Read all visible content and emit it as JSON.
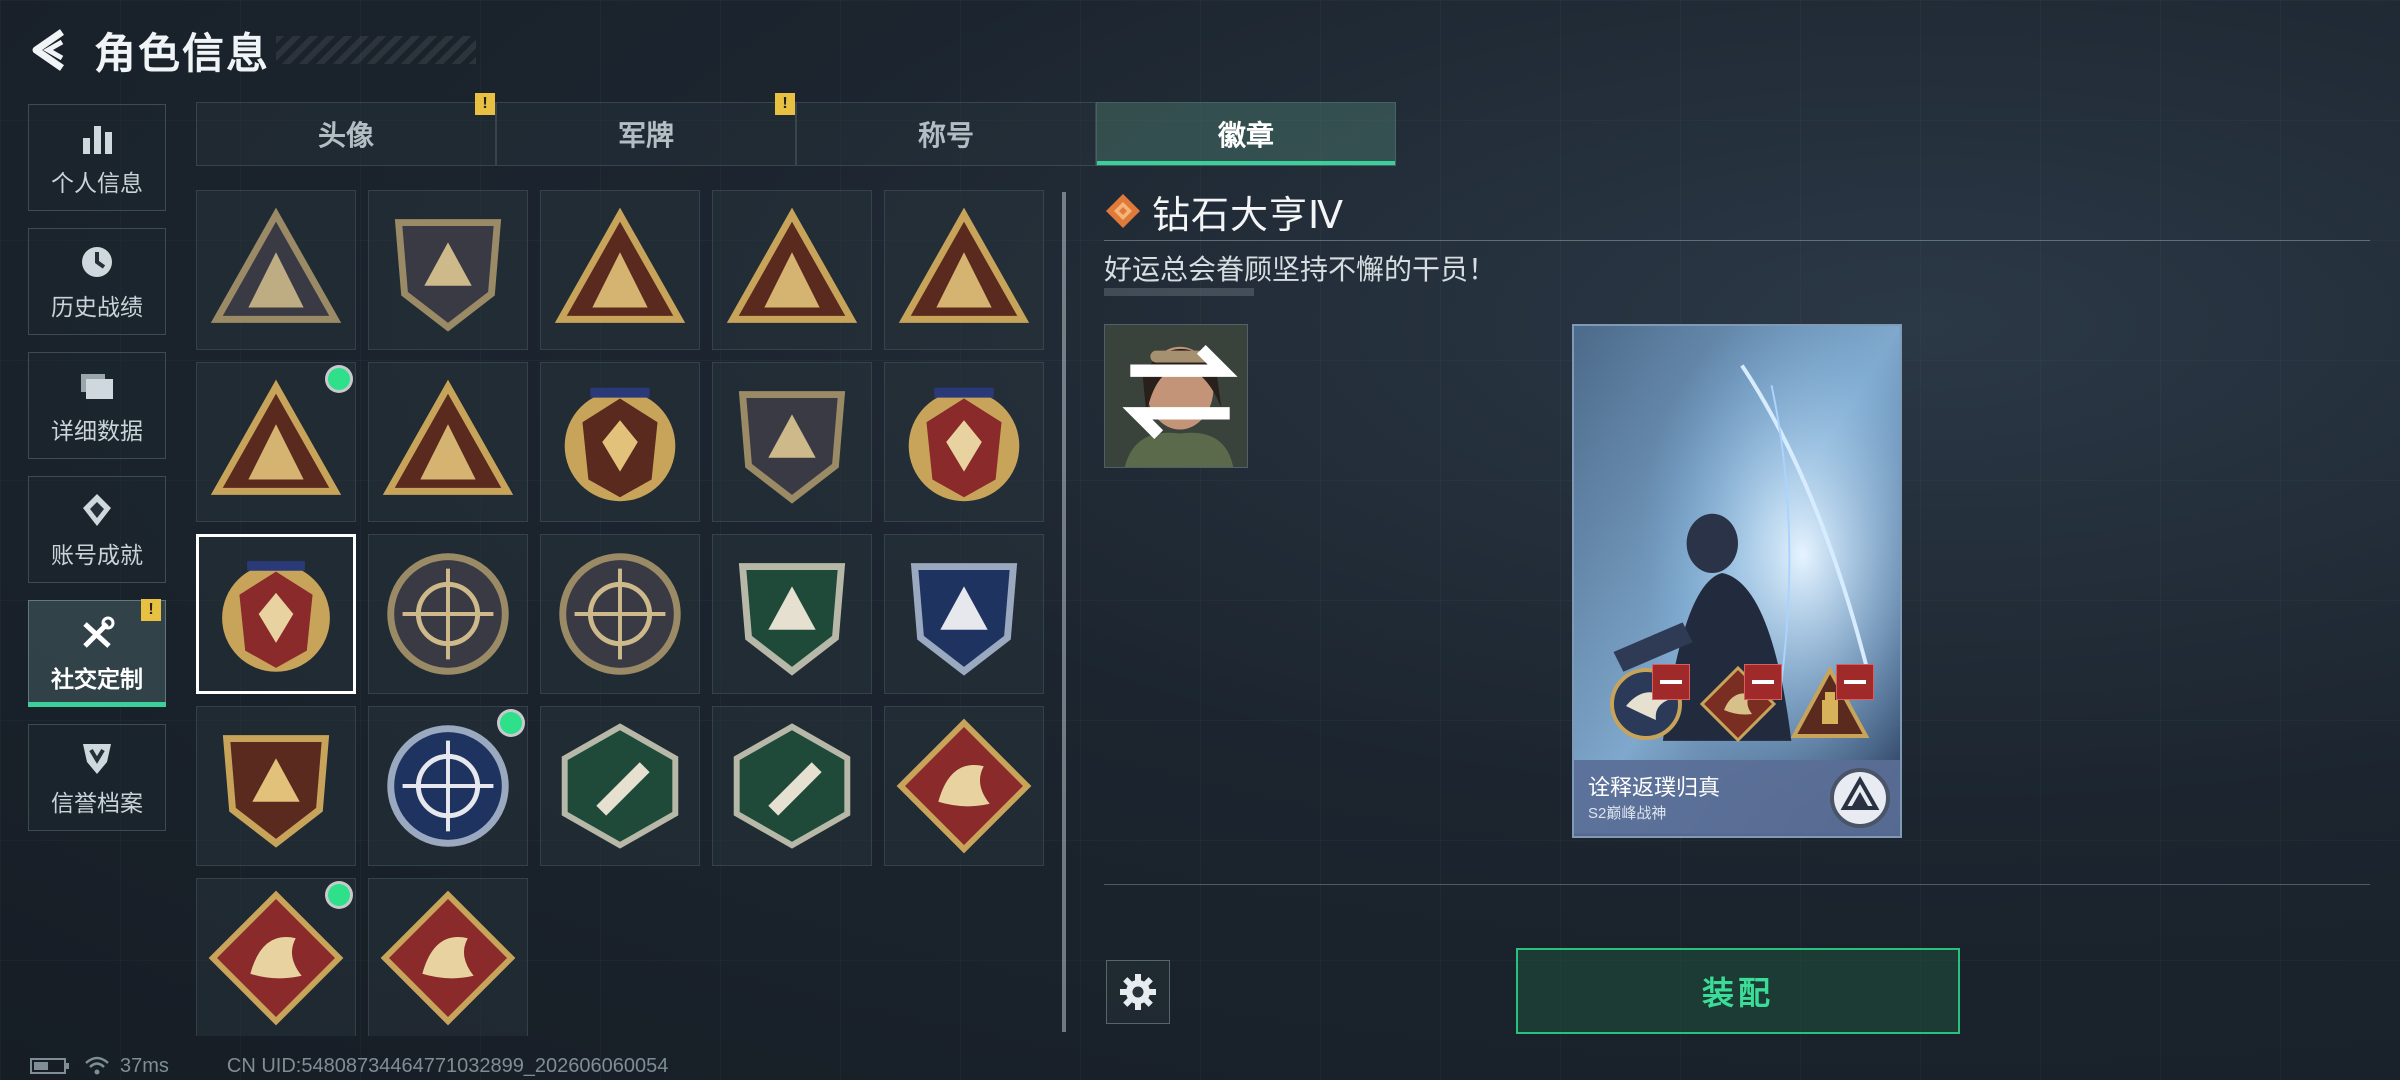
{
  "header": {
    "title": "角色信息"
  },
  "sidebar": {
    "items": [
      {
        "label": "个人信息",
        "icon": "stats-icon"
      },
      {
        "label": "历史战绩",
        "icon": "history-icon"
      },
      {
        "label": "详细数据",
        "icon": "folder-icon"
      },
      {
        "label": "账号成就",
        "icon": "achievement-icon"
      },
      {
        "label": "社交定制",
        "icon": "tools-icon",
        "active": true,
        "warning": "!"
      },
      {
        "label": "信誉档案",
        "icon": "shield-icon"
      }
    ]
  },
  "tabs": [
    {
      "label": "头像",
      "warning": "!"
    },
    {
      "label": "军牌",
      "warning": "!"
    },
    {
      "label": "称号"
    },
    {
      "label": "徽章",
      "active": true
    }
  ],
  "badges": [
    {
      "name": "triangle-shield-badge",
      "palette": "bronze"
    },
    {
      "name": "helicopter-badge",
      "palette": "bronze"
    },
    {
      "name": "s6-triangle-badge",
      "palette": "gold"
    },
    {
      "name": "s1-triangle-badge",
      "palette": "gold"
    },
    {
      "name": "number-one-triangle-badge",
      "palette": "gold"
    },
    {
      "name": "usb-triangle-badge",
      "palette": "gold",
      "new": true
    },
    {
      "name": "soldiers-triangle-badge",
      "palette": "gold"
    },
    {
      "name": "star-skull-badge",
      "palette": "gold"
    },
    {
      "name": "wing-shield-badge",
      "palette": "bronze"
    },
    {
      "name": "red-laurel-badge",
      "palette": "red"
    },
    {
      "name": "red-diamond-laurel-badge",
      "palette": "red",
      "selected": true
    },
    {
      "name": "crosshair-skull-badge",
      "palette": "bronze"
    },
    {
      "name": "crosshair-bomb-badge",
      "palette": "bronze"
    },
    {
      "name": "green-rifle-shield-badge",
      "palette": "green"
    },
    {
      "name": "blue-rifle-shield-badge",
      "palette": "blue"
    },
    {
      "name": "sword-shield-badge",
      "palette": "gold"
    },
    {
      "name": "eagle-badge",
      "palette": "blue",
      "new": true
    },
    {
      "name": "wasp-badge",
      "palette": "green"
    },
    {
      "name": "pistol-badge",
      "palette": "green"
    },
    {
      "name": "dragon-badge",
      "palette": "red"
    },
    {
      "name": "red-dragon-badge",
      "palette": "red",
      "new": true
    },
    {
      "name": "runner-badge",
      "palette": "red"
    }
  ],
  "detail": {
    "name": "钻石大亨Ⅳ",
    "description": "好运总会眷顾坚持不懈的干员！",
    "card": {
      "title": "诠释返璞归真",
      "subtitle": "S2巅峰战神"
    }
  },
  "equip_label": "装配",
  "status": {
    "ping": "37ms",
    "uid": "CN UID:54808734464771032899_202606060054"
  },
  "colors": {
    "accent": "#3bd09a",
    "warning": "#e8c142",
    "new_dot": "#2ee08a",
    "selected_border": "#ffffff"
  }
}
